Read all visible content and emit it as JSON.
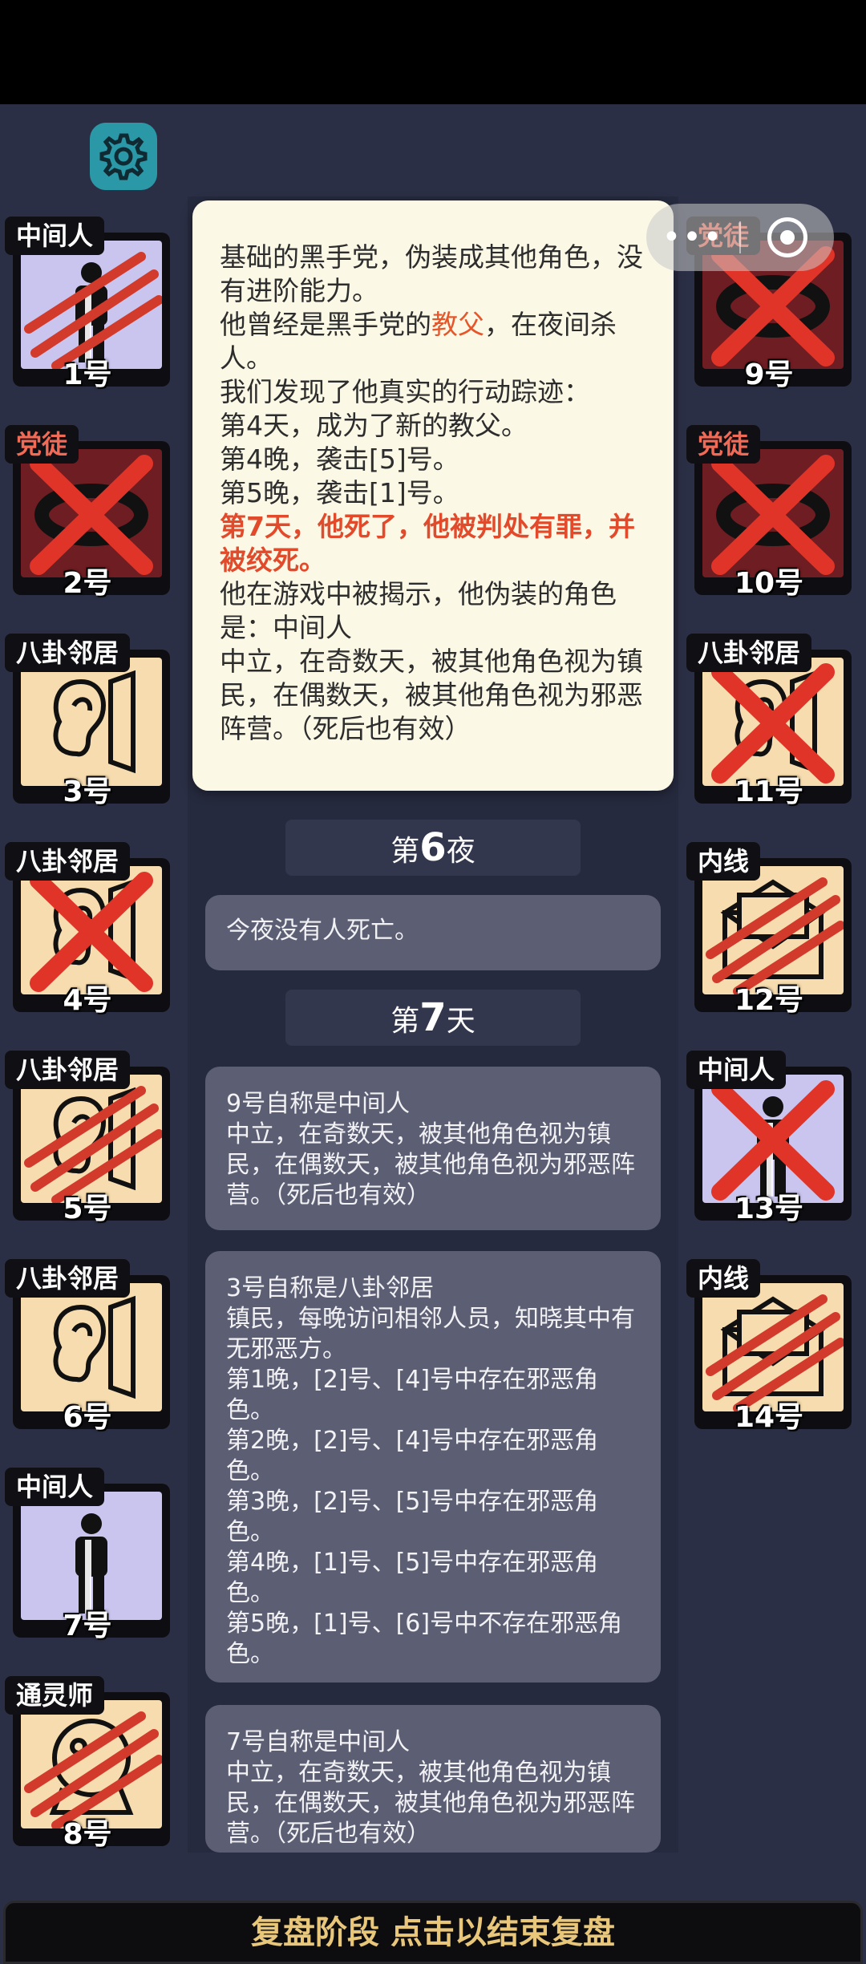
{
  "settings_icon": "gear-icon",
  "mini_program": {
    "more_icon": "more-dots-icon",
    "close_icon": "target-circle-icon"
  },
  "left_players": [
    {
      "role": "中间人",
      "number": "1号",
      "icon": "person-icon",
      "status": "clawed"
    },
    {
      "role": "党徒",
      "number": "2号",
      "icon": "ring-icon",
      "status": "crossed"
    },
    {
      "role": "八卦邻居",
      "number": "3号",
      "icon": "ear-icon",
      "status": "alive"
    },
    {
      "role": "八卦邻居",
      "number": "4号",
      "icon": "ear-icon",
      "status": "crossed"
    },
    {
      "role": "八卦邻居",
      "number": "5号",
      "icon": "ear-icon",
      "status": "clawed"
    },
    {
      "role": "八卦邻居",
      "number": "6号",
      "icon": "ear-icon",
      "status": "alive"
    },
    {
      "role": "中间人",
      "number": "7号",
      "icon": "person-icon",
      "status": "alive"
    },
    {
      "role": "通灵师",
      "number": "8号",
      "icon": "crystal-ball-icon",
      "status": "clawed"
    }
  ],
  "right_players": [
    {
      "role": "党徒",
      "number": "9号",
      "icon": "ring-icon",
      "status": "crossed"
    },
    {
      "role": "党徒",
      "number": "10号",
      "icon": "ring-icon",
      "status": "crossed"
    },
    {
      "role": "八卦邻居",
      "number": "11号",
      "icon": "ear-icon",
      "status": "crossed"
    },
    {
      "role": "内线",
      "number": "12号",
      "icon": "envelope-icon",
      "status": "clawed"
    },
    {
      "role": "中间人",
      "number": "13号",
      "icon": "person-icon",
      "status": "crossed"
    },
    {
      "role": "内线",
      "number": "14号",
      "icon": "envelope-icon",
      "status": "clawed"
    }
  ],
  "popup": {
    "line1": "基础的黑手党，伪装成其他角色，没有进阶能力。",
    "line2_a": "他曾经是黑手党的",
    "line2_hl": "教父",
    "line2_b": "，在夜间杀人。",
    "line3": "我们发现了他真实的行动踪迹：",
    "line4": "第4天，成为了新的教父。",
    "line5": "第4晚，袭击[5]号。",
    "line6": "第5晚，袭击[1]号。",
    "line7": "第7天，他死了，他被判处有罪，并被绞死。",
    "line8": "他在游戏中被揭示，他伪装的角色是：中间人",
    "line9": "中立，在奇数天，被其他角色视为镇民，在偶数天，被其他角色视为邪恶阵营。（死后也有效）"
  },
  "night6": {
    "prefix": "第",
    "num": "6",
    "suffix": "夜"
  },
  "night6_msg": "今夜没有人死亡。",
  "day7": {
    "prefix": "第",
    "num": "7",
    "suffix": "天"
  },
  "msg_9": {
    "title": "9号自称是中间人",
    "body": "中立，在奇数天，被其他角色视为镇民，在偶数天，被其他角色视为邪恶阵营。（死后也有效）"
  },
  "msg_3": {
    "title": "3号自称是八卦邻居",
    "body": "镇民，每晚访问相邻人员，知晓其中有无邪恶方。",
    "n1": "第1晚，[2]号、[4]号中存在邪恶角色。",
    "n2": "第2晚，[2]号、[4]号中存在邪恶角色。",
    "n3": "第3晚，[2]号、[5]号中存在邪恶角色。",
    "n4": "第4晚，[1]号、[5]号中存在邪恶角色。",
    "n5": "第5晚，[1]号、[6]号中不存在邪恶角色。"
  },
  "msg_7": {
    "title": "7号自称是中间人",
    "body": "中立，在奇数天，被其他角色视为镇民，在偶数天，被其他角色视为邪恶阵营。（死后也有效）"
  },
  "bottom_bar": "复盘阶段 点击以结束复盘"
}
